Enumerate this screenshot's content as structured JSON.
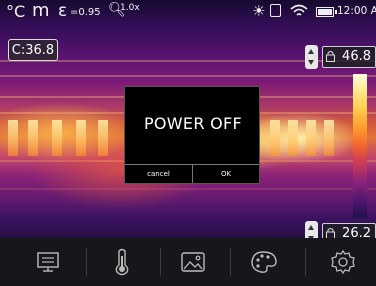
{
  "status": {
    "unit": "°C",
    "mode": "m",
    "emissivity_symbol": "ε",
    "emissivity": "=0.95",
    "zoom": "1.0x",
    "time": "12:00 A"
  },
  "center_temp": "C:36.8",
  "scale": {
    "max": "46.8",
    "min": "26.2"
  },
  "dialog": {
    "message": "POWER OFF",
    "cancel": "cancel",
    "ok": "OK"
  },
  "toolbar": [
    "display-icon",
    "thermometer-icon",
    "image-gallery-icon",
    "palette-icon",
    "settings-gear-icon"
  ]
}
